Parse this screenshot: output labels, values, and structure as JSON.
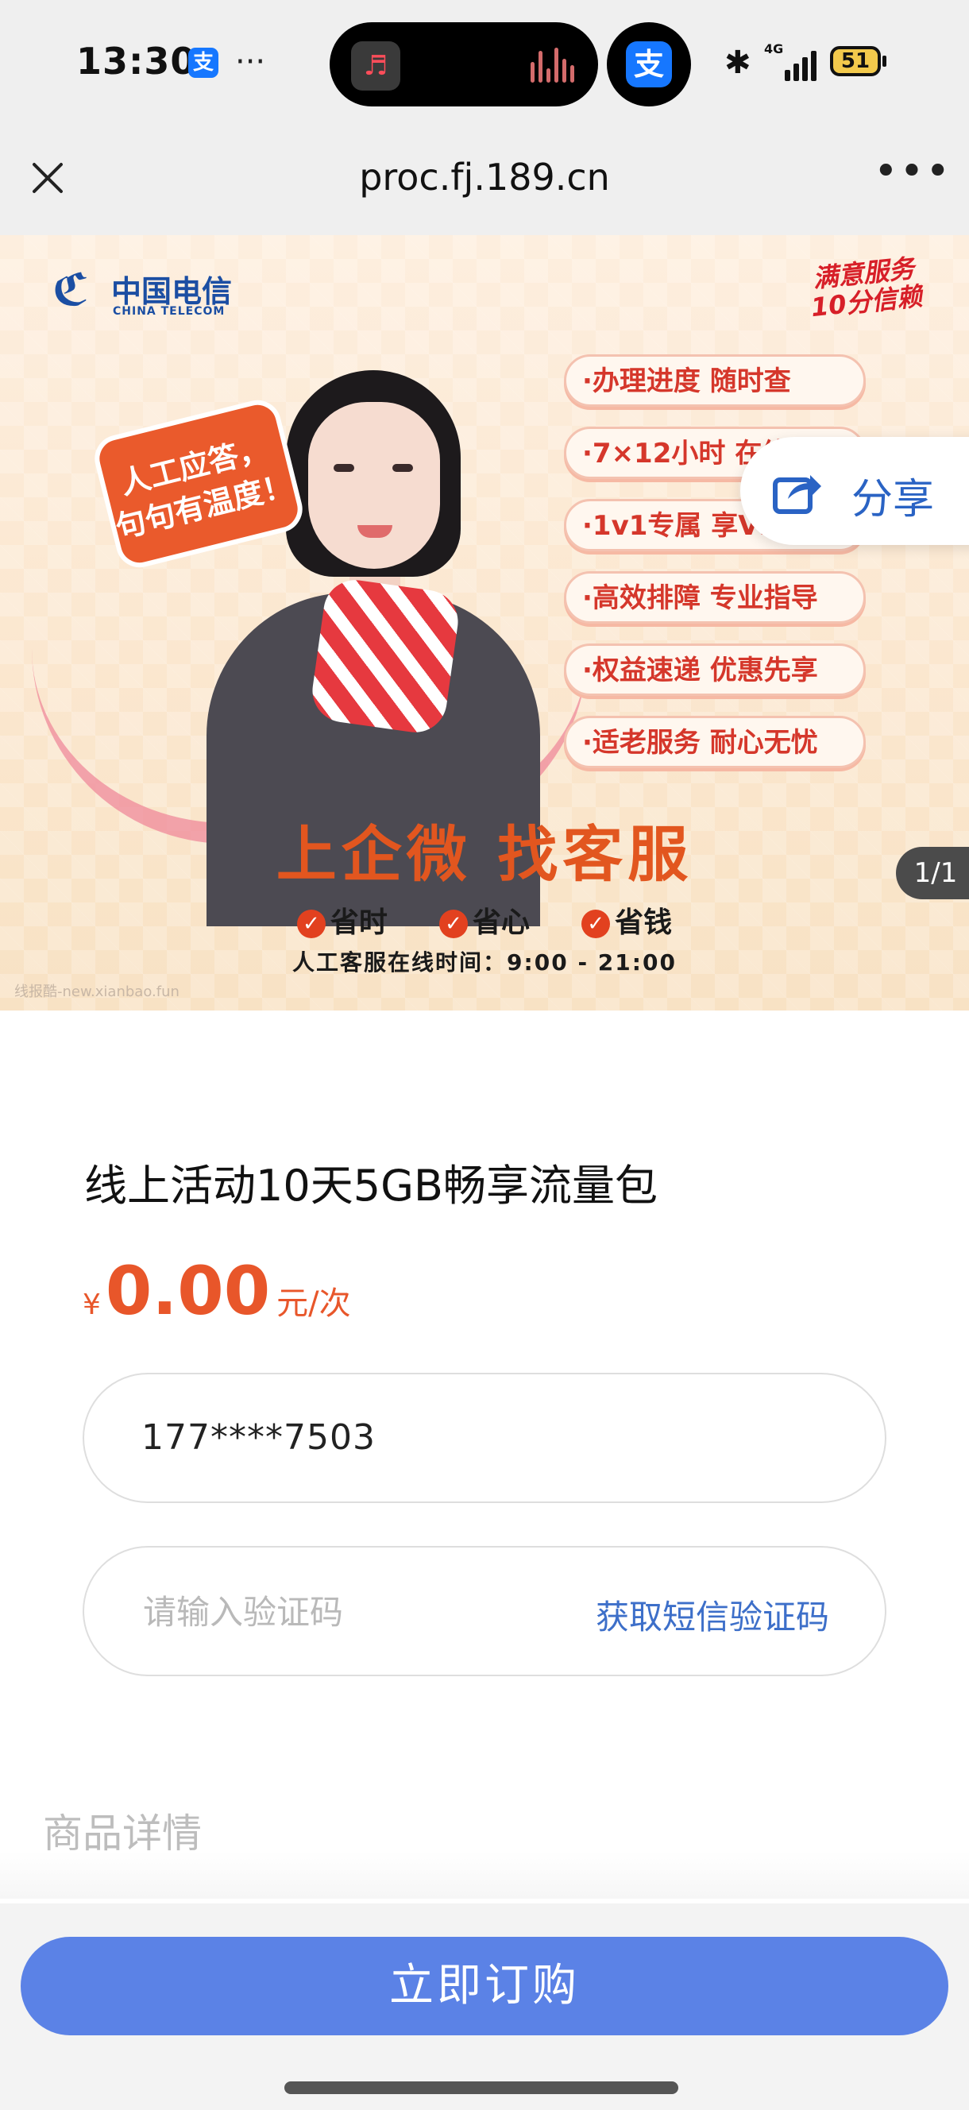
{
  "status_bar": {
    "time": "13:30",
    "alipay_glyph": "支",
    "more_dots": "···",
    "network": "4G",
    "battery": "51"
  },
  "browser": {
    "url": "proc.fj.189.cn",
    "more": "•••"
  },
  "banner": {
    "logo_cn": "中国电信",
    "logo_en": "CHINA TELECOM",
    "seal_line1": "满意服务",
    "seal_line2": "10分信赖",
    "bubble_line1": "人工应答，",
    "bubble_line2": "句句有温度！",
    "features": [
      "·办理进度  随时查",
      "·7×12小时  在线",
      "·1v1专属  享VIP",
      "·高效排障  专业指导",
      "·权益速递  优惠先享",
      "·适老服务  耐心无忧"
    ],
    "headline": "上企微  找客服",
    "benefits": [
      "省时",
      "省心",
      "省钱"
    ],
    "hours": "人工客服在线时间：9:00 - 21:00",
    "watermark": "线报酷-new.xianbao.fun",
    "counter": "1/1"
  },
  "share": {
    "label": "分享"
  },
  "product": {
    "title": "线上活动10天5GB畅享流量包",
    "currency": "¥",
    "price": "0.00",
    "unit": "元/次",
    "phone": "177****7503",
    "code_placeholder": "请输入验证码",
    "sms_button": "获取短信验证码",
    "details_title": "商品详情"
  },
  "buy_button": "立即订购",
  "colors": {
    "accent": "#5b82e6",
    "price": "#e8562a",
    "link": "#3d6fc9"
  }
}
